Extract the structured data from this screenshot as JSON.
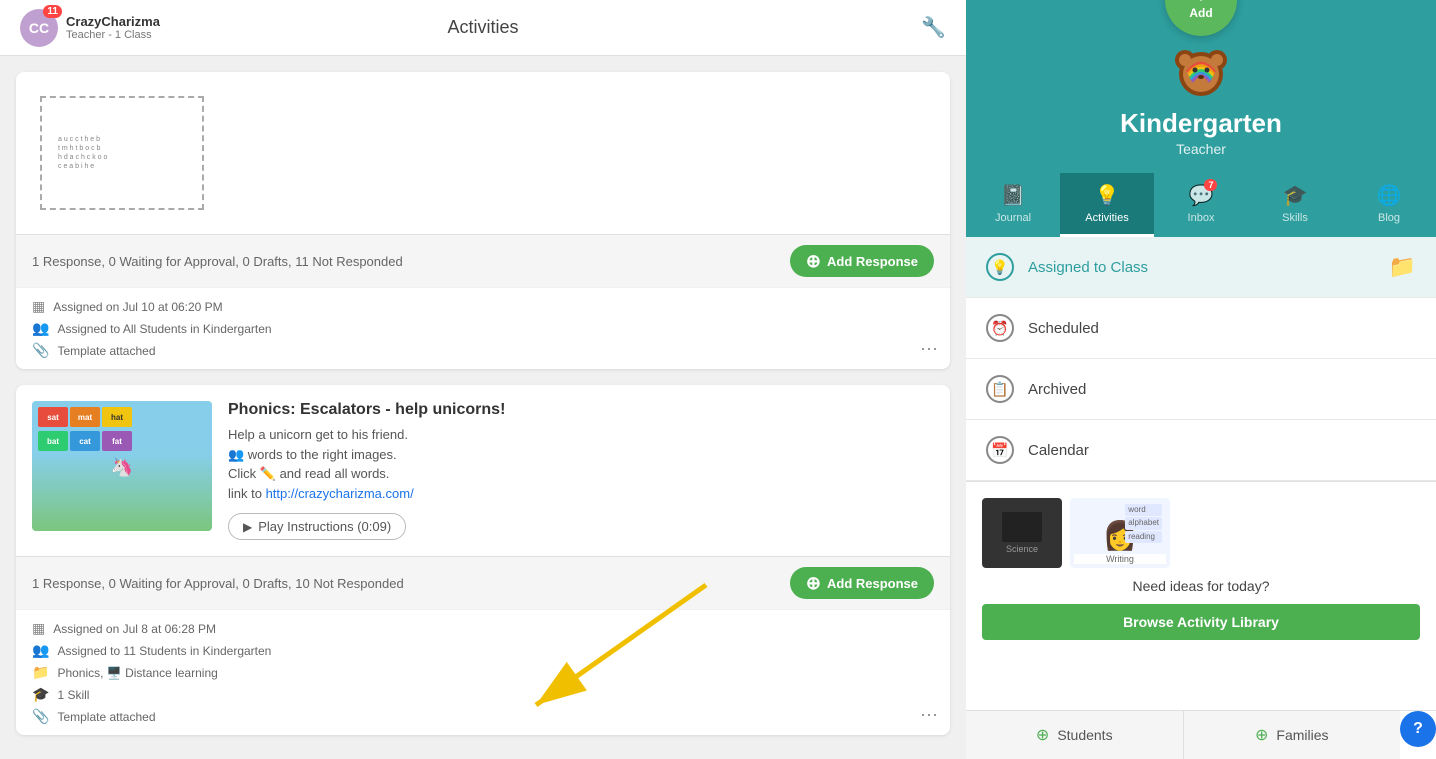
{
  "topbar": {
    "user": {
      "name": "CrazyCharizma",
      "role": "Teacher - 1 Class",
      "avatar_initials": "CC",
      "badge_count": "11"
    },
    "title": "Activities",
    "wrench_icon": "🔧"
  },
  "cards": [
    {
      "id": "card1",
      "response_bar": {
        "text": "1 Response, 0 Waiting for Approval, 0 Drafts, 11 Not Responded",
        "add_button": "Add Response"
      },
      "meta": [
        {
          "icon": "grid",
          "text": "Assigned on Jul 10 at 06:20 PM"
        },
        {
          "icon": "people",
          "text": "Assigned to All Students in Kindergarten"
        },
        {
          "icon": "paperclip",
          "text": "Template attached"
        }
      ]
    },
    {
      "id": "card2",
      "title": "Phonics: Escalators - help unicorns!",
      "description_lines": [
        "Help a unicorn get to his friend.",
        " words to the right images.",
        "Click  and read all words.",
        "link to http://crazycharizma.com/"
      ],
      "description_plain": "Help a unicorn get to his friend.",
      "desc_line2": "words to the right images.",
      "desc_line3": "and read all words.",
      "desc_link_text": "link to ",
      "desc_link": "http://crazycharizma.com/",
      "play_button": "Play Instructions (0:09)",
      "response_bar": {
        "text": "1 Response, 0 Waiting for Approval, 0 Drafts, 10 Not Responded",
        "add_button": "Add Response"
      },
      "meta": [
        {
          "icon": "grid",
          "text": "Assigned on Jul 8 at 06:28 PM"
        },
        {
          "icon": "people",
          "text": "Assigned to 11 Students in Kindergarten"
        },
        {
          "icon": "folder",
          "text": "Phonics, Distance learning"
        },
        {
          "icon": "graduate",
          "text": "1 Skill"
        },
        {
          "icon": "paperclip",
          "text": "Template attached"
        }
      ]
    }
  ],
  "sidebar": {
    "add_button": "Add",
    "school_name": "Kindergarten",
    "school_role": "Teacher",
    "nav_tabs": [
      {
        "id": "journal",
        "label": "Journal",
        "icon": "📓",
        "active": false
      },
      {
        "id": "activities",
        "label": "Activities",
        "icon": "💡",
        "active": true
      },
      {
        "id": "inbox",
        "label": "Inbox",
        "icon": "💬",
        "badge": "7",
        "active": false
      },
      {
        "id": "skills",
        "label": "Skills",
        "icon": "🎓",
        "active": false
      },
      {
        "id": "blog",
        "label": "Blog",
        "icon": "🌐",
        "active": false
      }
    ],
    "menu_items": [
      {
        "id": "assigned",
        "label": "Assigned to Class",
        "icon": "💡",
        "active": true
      },
      {
        "id": "scheduled",
        "label": "Scheduled",
        "icon": "⏰",
        "active": false
      },
      {
        "id": "archived",
        "label": "Archived",
        "icon": "📋",
        "active": false
      },
      {
        "id": "calendar",
        "label": "Calendar",
        "icon": "📅",
        "active": false
      }
    ],
    "ideas": {
      "text": "Need ideas for today?",
      "browse_button": "Browse Activity Library"
    },
    "bottom_buttons": [
      {
        "id": "students",
        "label": "Students",
        "icon": "+"
      },
      {
        "id": "families",
        "label": "Families",
        "icon": "+"
      }
    ]
  }
}
